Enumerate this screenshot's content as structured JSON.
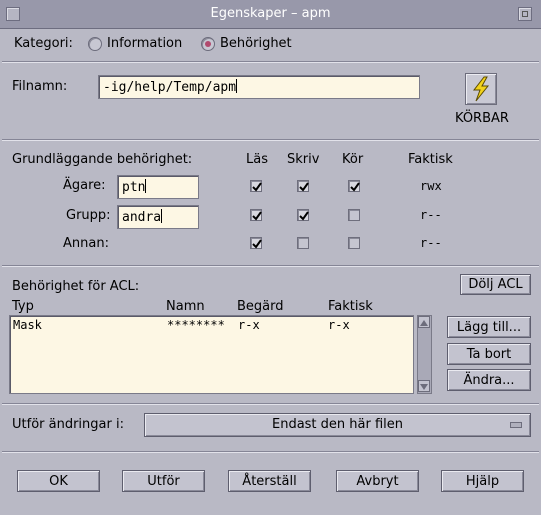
{
  "window": {
    "title": "Egenskaper – apm"
  },
  "category": {
    "label": "Kategori:",
    "options": [
      {
        "label": "Information",
        "selected": false
      },
      {
        "label": "Behörighet",
        "selected": true
      }
    ]
  },
  "file": {
    "label": "Filnamn:",
    "value": "-ig/help/Temp/apm",
    "icon": "lightning-executable-icon",
    "icon_caption": "KÖRBAR"
  },
  "basic": {
    "heading": "Grundläggande behörighet:",
    "columns": {
      "read": "Läs",
      "write": "Skriv",
      "exec": "Kör",
      "effective": "Faktisk"
    },
    "rows": [
      {
        "label": "Ägare:",
        "value": "ptn",
        "read": true,
        "write": true,
        "exec": true,
        "effective": "rwx"
      },
      {
        "label": "Grupp:",
        "value": "andra",
        "read": true,
        "write": true,
        "exec": false,
        "effective": "r--"
      },
      {
        "label": "Annan:",
        "value": "",
        "read": true,
        "write": false,
        "exec": false,
        "effective": "r--"
      }
    ]
  },
  "acl": {
    "heading": "Behörighet för ACL:",
    "hide_button": "Dölj ACL",
    "columns": {
      "type": "Typ",
      "name": "Namn",
      "requested": "Begärd",
      "effective": "Faktisk"
    },
    "rows": [
      {
        "type": "Mask",
        "name": "********",
        "requested": "r-x",
        "effective": "r-x"
      }
    ],
    "buttons": {
      "add": "Lägg till...",
      "remove": "Ta bort",
      "change": "Ändra..."
    }
  },
  "apply_to": {
    "label": "Utför ändringar i:",
    "value": "Endast den här filen"
  },
  "footer": {
    "ok": "OK",
    "apply": "Utför",
    "reset": "Återställ",
    "cancel": "Avbryt",
    "help": "Hjälp"
  },
  "colors": {
    "window_bg": "#b9b9c5",
    "titlebar": "#9898aa",
    "field_bg": "#fdf7e4",
    "radio_on": "#b14a6e",
    "icon_yellow": "#f2d21b"
  }
}
